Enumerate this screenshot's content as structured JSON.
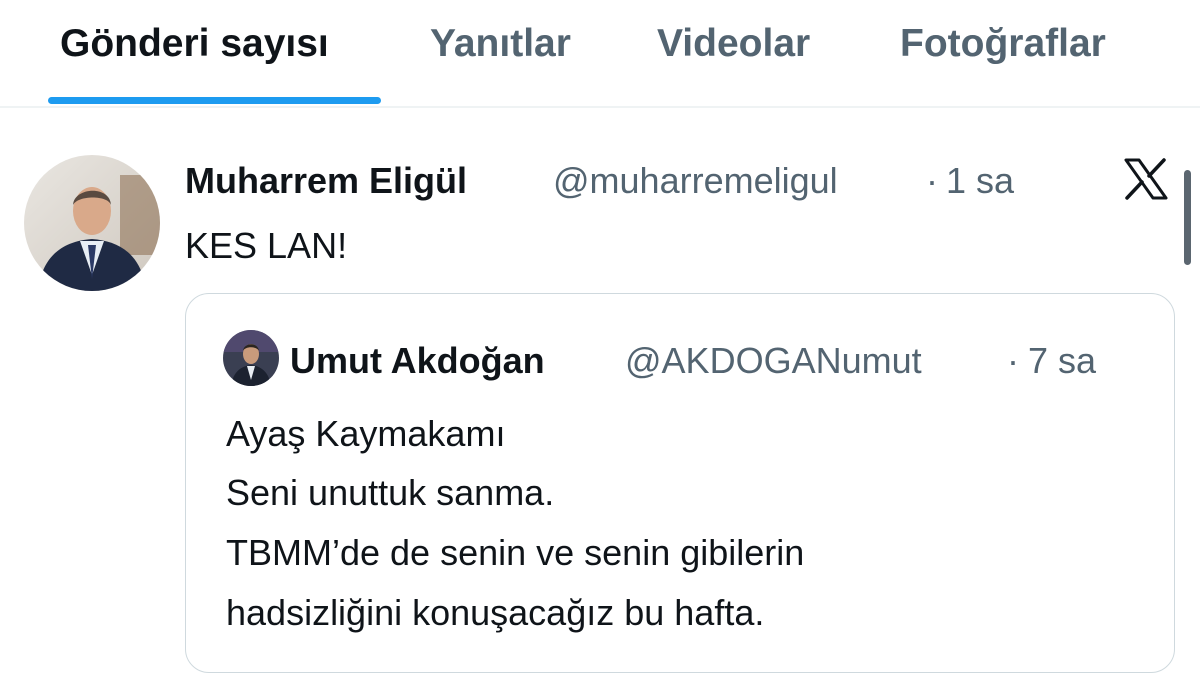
{
  "tabs": [
    {
      "label": "Gönderi sayısı",
      "active": true
    },
    {
      "label": "Yanıtlar",
      "active": false
    },
    {
      "label": "Videolar",
      "active": false
    },
    {
      "label": "Fotoğraflar",
      "active": false
    }
  ],
  "tweet": {
    "author_name": "Muharrem Eligül",
    "handle": "@muharremeligul",
    "separator": "·",
    "time": "1 sa",
    "text": "KES LAN!",
    "brand_icon": "x-logo-icon"
  },
  "quote": {
    "author_name": "Umut Akdoğan",
    "handle": "@AKDOGANumut",
    "separator": "·",
    "time": "7 sa",
    "lines": [
      "Ayaş Kaymakamı",
      "Seni unuttuk sanma.",
      "TBMM’de de senin ve senin gibilerin",
      "hadsizliğini konuşacağız bu hafta."
    ]
  },
  "colors": {
    "accent": "#1d9bf0",
    "primary_text": "#0f1419",
    "secondary_text": "#536471",
    "border": "#cfd9de"
  }
}
